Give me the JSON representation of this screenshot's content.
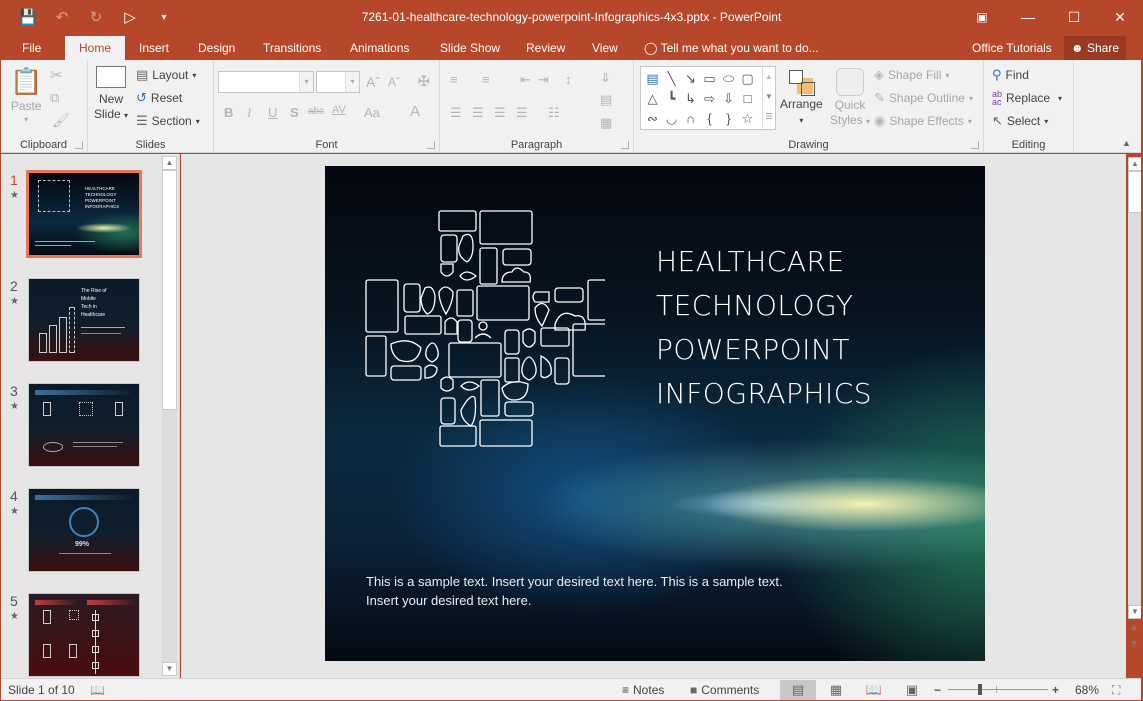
{
  "window": {
    "title": "7261-01-healthcare-technology-powerpoint-Infographics-4x3.pptx - PowerPoint",
    "qat": [
      "save-icon",
      "undo-icon",
      "redo-icon",
      "presenter-icon",
      "customize-qat-icon"
    ],
    "controls": [
      "ribbon-display-options-icon",
      "minimize-icon",
      "maximize-icon",
      "close-icon"
    ]
  },
  "tabs": {
    "file": "File",
    "home": "Home",
    "insert": "Insert",
    "design": "Design",
    "transitions": "Transitions",
    "animations": "Animations",
    "slideshow": "Slide Show",
    "review": "Review",
    "view": "View",
    "tell_me": "Tell me what you want to do...",
    "account": "Office Tutorials",
    "share": "Share",
    "active": "Home"
  },
  "ribbon": {
    "clipboard": {
      "label": "Clipboard",
      "paste": "Paste"
    },
    "slides": {
      "label": "Slides",
      "new_slide_1": "New",
      "new_slide_2": "Slide",
      "layout": "Layout",
      "reset": "Reset",
      "section": "Section"
    },
    "font": {
      "label": "Font",
      "font_name": "",
      "font_size": "",
      "bold": "B",
      "italic": "I",
      "underline": "U",
      "shadow": "S",
      "strike": "abc",
      "spacing": "AV",
      "case": "Aa",
      "color": "A"
    },
    "paragraph": {
      "label": "Paragraph"
    },
    "drawing": {
      "label": "Drawing",
      "arrange": "Arrange",
      "quick_styles_1": "Quick",
      "quick_styles_2": "Styles",
      "shape_fill": "Shape Fill",
      "shape_outline": "Shape Outline",
      "shape_effects": "Shape Effects"
    },
    "editing": {
      "label": "Editing",
      "find": "Find",
      "replace": "Replace",
      "select": "Select"
    }
  },
  "thumbnails": [
    {
      "number": "1",
      "title": "HEALTHCARE TECHNOLOGY POWERPOINT INFOGRAPHICS",
      "active": true
    },
    {
      "number": "2",
      "title": "The Rise of Mobile Tech in Healthcare",
      "active": false
    },
    {
      "number": "3",
      "title": "",
      "active": false
    },
    {
      "number": "4",
      "title": "99%",
      "active": false
    },
    {
      "number": "5",
      "title": "",
      "active": false
    }
  ],
  "slide": {
    "title": "HEALTHCARE\nTECHNOLOGY\nPOWERPOINT\nINFOGRAPHICS",
    "body": "This is a sample text. Insert your desired text here. This is a sample text. Insert your desired text here."
  },
  "status": {
    "slide_info": "Slide 1 of 10",
    "notes": "Notes",
    "comments": "Comments",
    "zoom_level": "68%",
    "zoom_percent": 68
  }
}
